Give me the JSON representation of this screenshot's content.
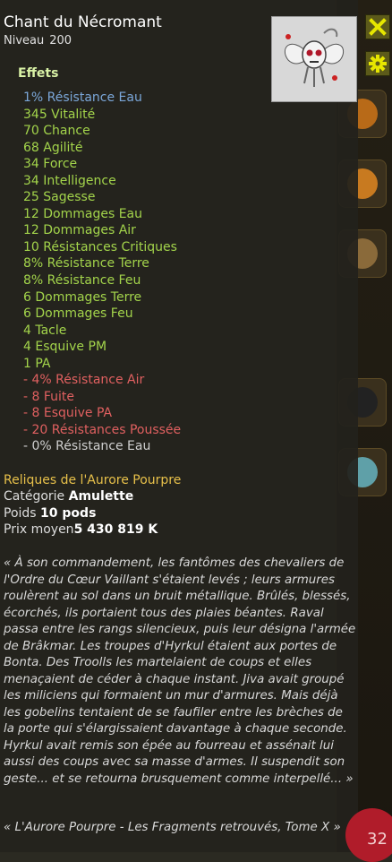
{
  "item": {
    "name": "Chant du Nécromant",
    "level_label": "Niveau",
    "level_value": "200"
  },
  "effects": {
    "title": "Effets",
    "lines": [
      {
        "text": "1% Résistance Eau",
        "color": "blue"
      },
      {
        "text": "345 Vitalité",
        "color": "green"
      },
      {
        "text": "70 Chance",
        "color": "green"
      },
      {
        "text": "68 Agilité",
        "color": "green"
      },
      {
        "text": "34 Force",
        "color": "green"
      },
      {
        "text": "34 Intelligence",
        "color": "green"
      },
      {
        "text": "25 Sagesse",
        "color": "green"
      },
      {
        "text": "12 Dommages Eau",
        "color": "green"
      },
      {
        "text": "12 Dommages Air",
        "color": "green"
      },
      {
        "text": "10 Résistances Critiques",
        "color": "green"
      },
      {
        "text": "8% Résistance Terre",
        "color": "green"
      },
      {
        "text": "8% Résistance Feu",
        "color": "green"
      },
      {
        "text": "6 Dommages Terre",
        "color": "green"
      },
      {
        "text": "6 Dommages Feu",
        "color": "green"
      },
      {
        "text": "4 Tacle",
        "color": "green"
      },
      {
        "text": "4 Esquive PM",
        "color": "green"
      },
      {
        "text": "1 PA",
        "color": "green"
      },
      {
        "text": "- 4% Résistance Air",
        "color": "red"
      },
      {
        "text": "- 8 Fuite",
        "color": "red"
      },
      {
        "text": "- 8 Esquive PA",
        "color": "red"
      },
      {
        "text": "- 20 Résistances Poussée",
        "color": "red"
      },
      {
        "text": "- 0% Résistance Eau",
        "color": "grey"
      }
    ]
  },
  "set": {
    "name": "Reliques de l'Aurore Pourpre"
  },
  "info": {
    "category_label": "Catégorie",
    "category_value": "Amulette",
    "weight_label": "Poids",
    "weight_value": "10 pods",
    "price_label": "Prix moyen",
    "price_value": "5 430 819 K"
  },
  "description": "« À son commandement, les fantômes des chevaliers de l'Ordre du Cœur Vaillant s'étaient levés ; leurs armures roulèrent au sol dans un bruit métallique. Brûlés, blessés, écorchés, ils portaient tous des plaies béantes. Raval passa entre les rangs silencieux, puis leur désigna l'armée de Brâkmar. Les troupes d'Hyrkul étaient aux portes de Bonta. Des Troolls les martelaient de coups et elles menaçaient de céder à chaque instant. Jiva avait groupé les miliciens qui formaient un mur d'armures. Mais déjà les gobelins tentaient de se faufiler entre les brèches de la porte qui s'élargissaient davantage à chaque seconde. Hyrkul avait remis son épée au fourreau et assénait lui aussi des coups avec sa masse d'armes. Il suspendit son geste... et se retourna brusquement comme interpellé... »",
  "source": "« L'Aurore Pourpre - Les Fragments retrouvés, Tome X »",
  "corner": {
    "number": "32"
  },
  "colors": {
    "blue": "#7ba7d9",
    "green": "#a3d44b",
    "red": "#e06060",
    "grey": "#cfcfcf",
    "set_name": "#e7c04a",
    "button_bg": "#5c5a1a",
    "button_icon": "#e6e600"
  },
  "icons": {
    "close": "close-icon",
    "settings": "gear-icon",
    "item": "necromancer-amulet-icon"
  }
}
